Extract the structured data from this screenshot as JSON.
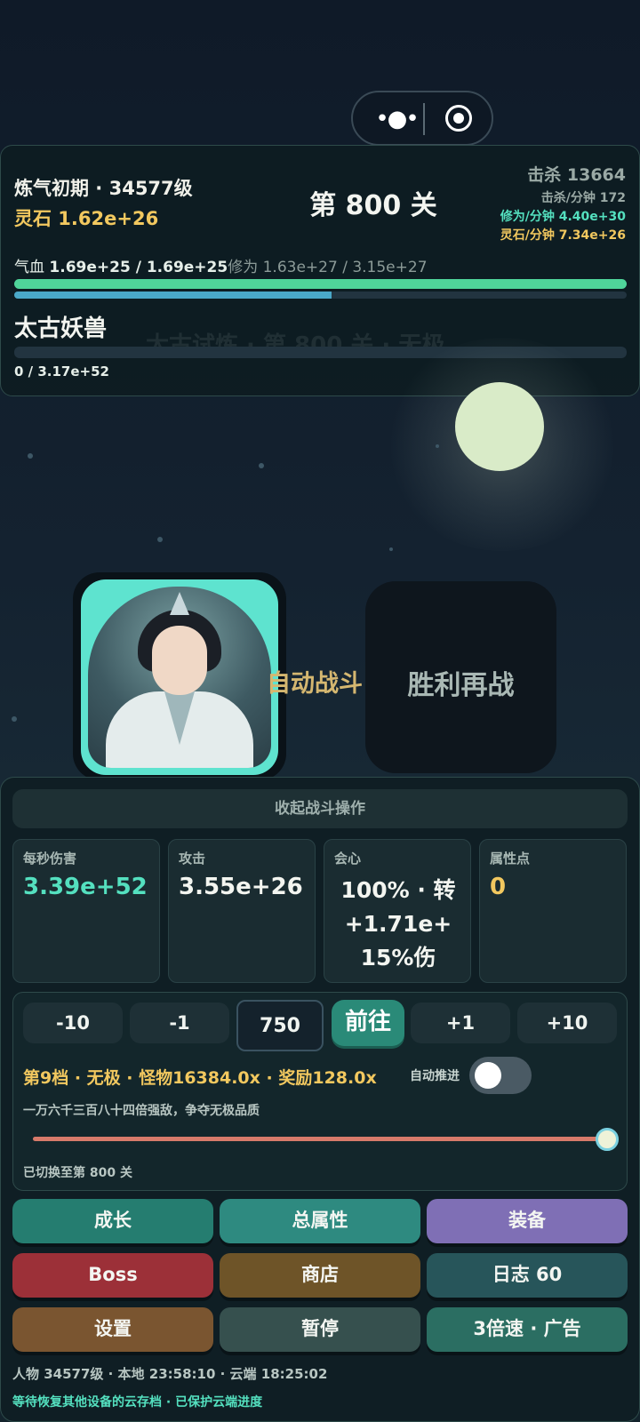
{
  "top": {
    "realm": "炼气初期 · 34577级",
    "stones": "灵石 1.62e+26",
    "stage": "第 800 关",
    "kills": "击杀 13664",
    "kills_per_min": "击杀/分钟 172",
    "xp_per_min": "修为/分钟 4.40e+30",
    "stones_per_min": "灵石/分钟 7.34e+26",
    "hp_label": "气血 ",
    "hp_value": "1.69e+25 / 1.69e+25",
    "xp_label": "修为 ",
    "xp_value": "1.63e+27 / 3.15e+27",
    "hp_progress": 1.0,
    "xp_progress": 0.5175,
    "enemy_name": "太古妖兽",
    "enemy_hp": "0 / 3.17e+52",
    "enemy_progress": 0.0,
    "ghost_text": "太古试炼 · 第 800 关 · 无极"
  },
  "scene": {
    "auto_fight": "自动战斗",
    "retry": "胜利再战"
  },
  "panel": {
    "collapse": "收起战斗操作",
    "stats": [
      {
        "label": "每秒伤害",
        "value": "3.39e+52",
        "color": "#54e0bf"
      },
      {
        "label": "攻击",
        "value": "3.55e+26",
        "color": "#f3f5f0"
      },
      {
        "label": "会心",
        "value": "100% · 转+1.71e+ 15%伤",
        "color": "#f3f5f0"
      },
      {
        "label": "属性点",
        "value": "0",
        "color": "#f2c85f"
      }
    ],
    "steps": {
      "m10": "-10",
      "m1": "-1",
      "p1": "+1",
      "p10": "+10"
    },
    "stage_input": "750",
    "go": "前往",
    "tier": "第9档 · 无极 · 怪物16384.0x · 奖励128.0x",
    "auto_advance": "自动推进",
    "auto_advance_on": false,
    "tier_desc": "一万六千三百八十四倍强敌，争夺无极品质",
    "tier_slider": 1.0,
    "switched": "已切换至第 800 关"
  },
  "actions": [
    {
      "label": "成长",
      "color": "#257d70"
    },
    {
      "label": "总属性",
      "color": "#2e8a80"
    },
    {
      "label": "装备",
      "color": "#7f6fb5"
    },
    {
      "label": "Boss",
      "color": "#9c3038"
    },
    {
      "label": "商店",
      "color": "#6e5428"
    },
    {
      "label": "日志 60",
      "color": "#27555a"
    },
    {
      "label": "设置",
      "color": "#7a5530"
    },
    {
      "label": "暂停",
      "color": "#36504e"
    },
    {
      "label": "3倍速 · 广告",
      "color": "#2b6e62"
    }
  ],
  "footer": {
    "line1": "人物 34577级 · 本地 23:58:10 · 云端 18:25:02",
    "line2": "等待恢复其他设备的云存档 · 已保护云端进度"
  }
}
